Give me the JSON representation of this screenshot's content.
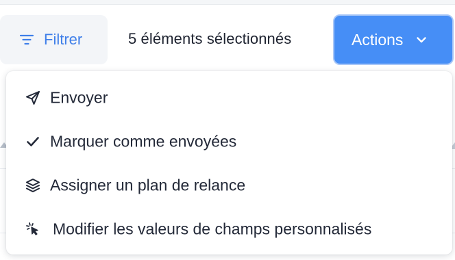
{
  "toolbar": {
    "filter_label": "Filtrer",
    "selection_text": "5 éléments sélectionnés",
    "actions_label": "Actions"
  },
  "colors": {
    "accent": "#468ef6",
    "filter_text": "#3f7fe9",
    "filter_bg": "#f3f5f8",
    "text": "#232938"
  },
  "icons": {
    "filter": "filter-icon",
    "actions_chevron": "chevron-down-icon",
    "send": "paper-plane-icon",
    "mark_sent": "checkmark-icon",
    "assign_plan": "layers-icon",
    "custom_fields": "cursor-click-icon"
  },
  "menu": {
    "items": [
      {
        "label": "Envoyer"
      },
      {
        "label": "Marquer comme envoyées"
      },
      {
        "label": "Assigner un plan de relance"
      },
      {
        "label": "Modifier les valeurs de champs personnalisés"
      }
    ]
  }
}
